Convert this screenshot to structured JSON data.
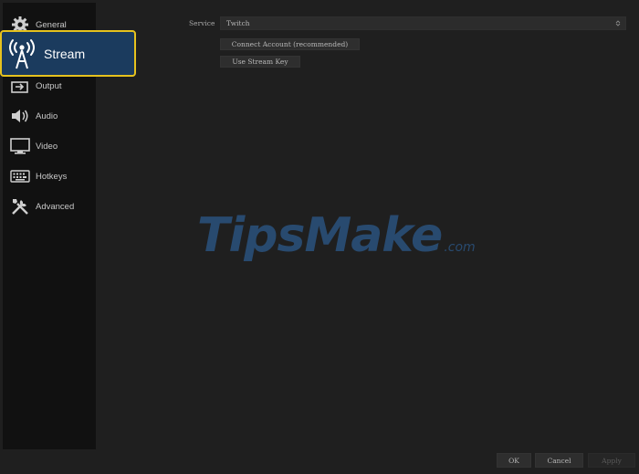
{
  "sidebar": {
    "items": [
      {
        "label": "General",
        "icon": "gear-icon"
      },
      {
        "label": "Stream",
        "icon": "broadcast-antenna-icon"
      },
      {
        "label": "Output",
        "icon": "output-icon"
      },
      {
        "label": "Audio",
        "icon": "speaker-icon"
      },
      {
        "label": "Video",
        "icon": "monitor-icon"
      },
      {
        "label": "Hotkeys",
        "icon": "keyboard-icon"
      },
      {
        "label": "Advanced",
        "icon": "tools-icon"
      }
    ],
    "selected": "Stream"
  },
  "main": {
    "service_label": "Service",
    "service_value": "Twitch",
    "connect_account_label": "Connect Account (recommended)",
    "use_stream_key_label": "Use Stream Key"
  },
  "watermark": {
    "text": "TipsMake",
    "suffix": ".com"
  },
  "footer": {
    "ok_label": "OK",
    "cancel_label": "Cancel",
    "apply_label": "Apply"
  },
  "colors": {
    "background": "#1f1f1f",
    "sidebar": "#111111",
    "highlight": "#1b3b5e",
    "highlight_border": "#e6c21e",
    "watermark": "#2a4f78"
  }
}
